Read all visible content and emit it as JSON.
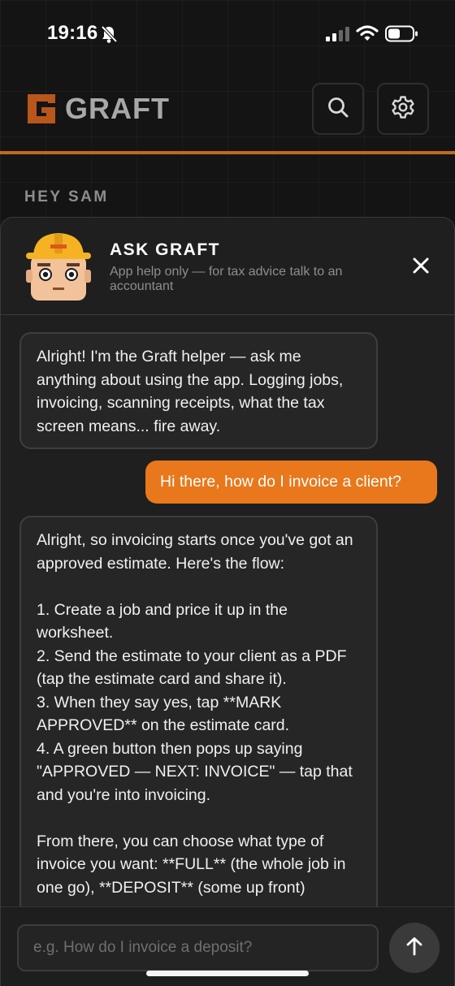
{
  "status_bar": {
    "time": "19:16",
    "icons": [
      "bell-slash-icon",
      "cellular-signal-icon",
      "wifi-icon",
      "battery-icon"
    ]
  },
  "header": {
    "logo_mark": "G",
    "logo_text": "GRAFT",
    "buttons": [
      "search-icon",
      "gear-icon"
    ],
    "accent_color": "#c06a1c"
  },
  "greeting": "HEY SAM",
  "chat": {
    "title": "ASK GRAFT",
    "subtitle": "App help only — for tax advice talk to an accountant",
    "close_icon": "close-icon",
    "messages": [
      {
        "role": "assistant",
        "text": "Alright! I'm the Graft helper — ask me anything about using the app. Logging jobs, invoicing, scanning receipts, what the tax screen means... fire away."
      },
      {
        "role": "user",
        "text": "Hi there, how do I invoice a client?"
      },
      {
        "role": "assistant",
        "text": "Alright, so invoicing starts once you've got an approved estimate. Here's the flow:\n\n1. Create a job and price it up in the worksheet.\n2. Send the estimate to your client as a PDF (tap the estimate card and share it).\n3. When they say yes, tap **MARK APPROVED** on the estimate card.\n4. A green button then pops up saying \"APPROVED — NEXT: INVOICE\" — tap that and you're into invoicing.\n\nFrom there, you can choose what type of invoice you want: **FULL** (the whole job in one go), **DEPOSIT** (some up front)"
      }
    ],
    "input_placeholder": "e.g. How do I invoice a deposit?",
    "send_icon": "arrow-up-icon",
    "user_bubble_color": "#e8781b"
  }
}
